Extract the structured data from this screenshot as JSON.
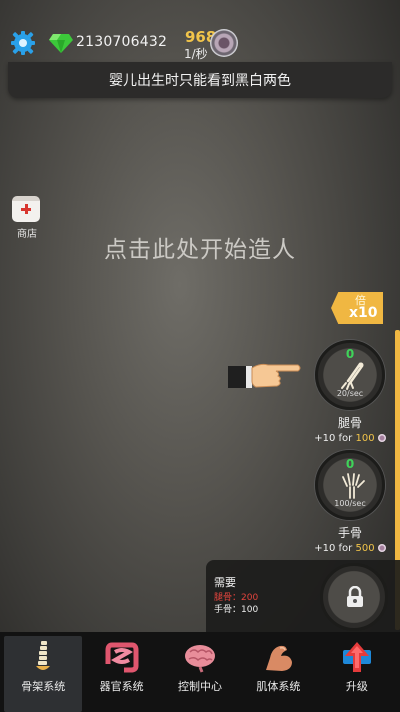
{
  "header": {
    "settings_icon": "gear-icon",
    "gem_icon": "green-diamond-icon",
    "gem_count": "2130706432",
    "cell_rate": "968",
    "cell_rate_unit": "1/秒",
    "cell_icon": "cell-icon"
  },
  "tip_banner": "婴儿出生时只能看到黑白两色",
  "shop": {
    "label": "商店",
    "icon": "first-aid-kit-icon"
  },
  "start_hint": "点击此处开始造人",
  "multiplier": {
    "char": "倍",
    "value": "x10"
  },
  "bones": [
    {
      "name": "腿骨",
      "count": "0",
      "rate": "20/sec",
      "cost_prefix": "+10 for ",
      "cost_value": "100",
      "icon": "leg-bone-icon"
    },
    {
      "name": "手骨",
      "count": "0",
      "rate": "100/sec",
      "cost_prefix": "+10 for ",
      "cost_value": "500",
      "icon": "hand-bone-icon"
    }
  ],
  "requirement": {
    "title": "需要",
    "line1": "腿骨：200",
    "line2": "手骨：100"
  },
  "nav": [
    {
      "label": "骨架系统",
      "icon": "spine-icon",
      "active": true
    },
    {
      "label": "器官系统",
      "icon": "intestine-icon",
      "active": false
    },
    {
      "label": "控制中心",
      "icon": "brain-icon",
      "active": false
    },
    {
      "label": "肌体系统",
      "icon": "arm-muscle-icon",
      "active": false
    },
    {
      "label": "升级",
      "icon": "upgrade-arrow-icon",
      "active": false
    }
  ],
  "colors": {
    "accent": "#f0b742",
    "green_count": "#3fd45a",
    "gold": "#f2c54a",
    "red": "#e2443d"
  }
}
